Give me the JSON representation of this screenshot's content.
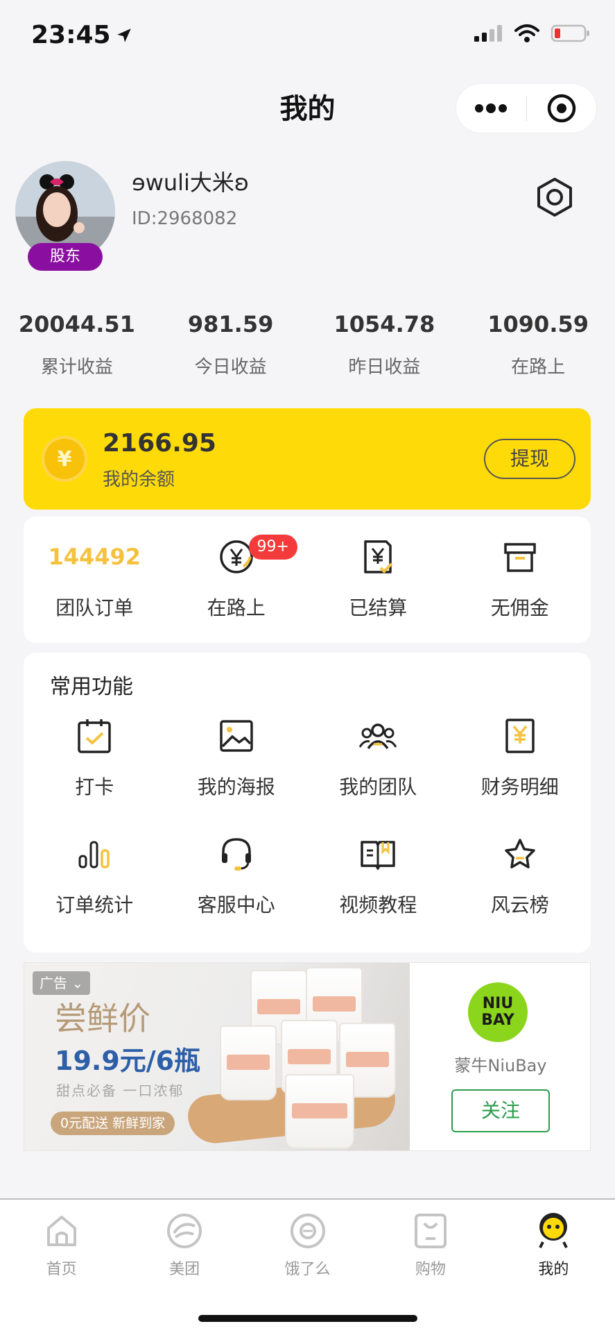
{
  "status_bar": {
    "time": "23:45"
  },
  "header": {
    "title": "我的"
  },
  "profile": {
    "nickname": "ɘwuli大米ʚ",
    "id_text": "ID:2968082",
    "badge": "股东"
  },
  "stats": [
    {
      "value": "20044.51",
      "label": "累计收益"
    },
    {
      "value": "981.59",
      "label": "今日收益"
    },
    {
      "value": "1054.78",
      "label": "昨日收益"
    },
    {
      "value": "1090.59",
      "label": "在路上"
    }
  ],
  "balance": {
    "coin_symbol": "¥",
    "amount": "2166.95",
    "label": "我的余额",
    "withdraw_label": "提现"
  },
  "orders": {
    "team_orders_value": "144492",
    "items": [
      {
        "label": "团队订单"
      },
      {
        "label": "在路上",
        "badge": "99+"
      },
      {
        "label": "已结算"
      },
      {
        "label": "无佣金"
      }
    ]
  },
  "functions": {
    "title": "常用功能",
    "items": [
      {
        "label": "打卡",
        "icon": "calendar-check-icon"
      },
      {
        "label": "我的海报",
        "icon": "image-icon"
      },
      {
        "label": "我的团队",
        "icon": "team-icon"
      },
      {
        "label": "财务明细",
        "icon": "finance-icon"
      },
      {
        "label": "订单统计",
        "icon": "bar-stats-icon"
      },
      {
        "label": "客服中心",
        "icon": "headset-icon"
      },
      {
        "label": "视频教程",
        "icon": "book-icon"
      },
      {
        "label": "风云榜",
        "icon": "star-icon"
      }
    ]
  },
  "ad": {
    "tag": "广告 ⌄",
    "headline": "尝鲜价",
    "price": "19.9元/6瓶",
    "sub": "甜点必备 一口浓郁",
    "pill": "0元配送 新鲜到家",
    "brand_logo": "NIU BAY",
    "brand_name": "蒙牛NiuBay",
    "follow_label": "关注"
  },
  "tabbar": {
    "items": [
      {
        "label": "首页",
        "icon": "home-icon"
      },
      {
        "label": "美团",
        "icon": "meituan-icon"
      },
      {
        "label": "饿了么",
        "icon": "eleme-icon"
      },
      {
        "label": "购物",
        "icon": "shopping-icon"
      },
      {
        "label": "我的",
        "icon": "profile-mascot-icon",
        "active": true
      }
    ]
  },
  "colors": {
    "accent_yellow": "#fedb08",
    "badge_purple": "#8a0fa0",
    "badge_red": "#f43b3b",
    "follow_green": "#2c9c4c"
  }
}
